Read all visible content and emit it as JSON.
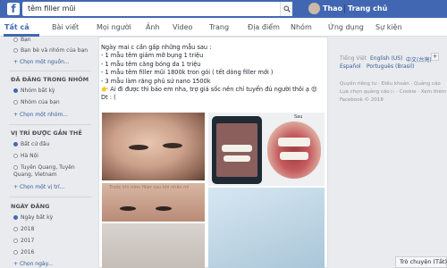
{
  "topbar": {
    "logo": "f",
    "search_value": "têm filler mũi",
    "username": "Thao",
    "home_label": "Trang chủ"
  },
  "tabs": [
    "Tất cả",
    "Bài viết",
    "Mọi người",
    "Ảnh",
    "Video",
    "Trang",
    "Địa điểm",
    "Nhóm",
    "Ứng dụng",
    "Sự kiện"
  ],
  "sidebar": {
    "group1_items": [
      "Bạn",
      "Bạn bè và nhóm của bạn"
    ],
    "group1_link": "Chọn một nguồn...",
    "section2_title": "ĐĂ ĐĂNG TRONG NHÓM",
    "section2_items": [
      "Nhóm bất kỳ",
      "Nhóm của bạn"
    ],
    "section2_link": "Chọn một nhóm...",
    "section3_title": "VỊ TRÍ ĐƯỢC GẮN THẺ",
    "section3_items": [
      "Bất cứ đâu",
      "Hà Nội",
      "Tuyên Quang, Tuyên Quang, Vietnam"
    ],
    "section3_link": "Chọn một vị trí...",
    "section4_title": "NGÀY ĐĂNG",
    "section4_items": [
      "Ngày bất kỳ",
      "2018",
      "2017",
      "2016"
    ],
    "section4_link": "Chọn ngày..."
  },
  "post": {
    "line1": "Ngày mai c cần gấp những mẫu sau :",
    "line2": "- 1 mẫu têm giảm mỡ bụng 1 triệu",
    "line3": "- 1 mẫu têm căng bóng da 1 triệu",
    "line4": "- 1 mẫu têm filler mũi 1800k tron gói ( tết dòng filler mới )",
    "line5": "- 3 mẫu làm răng phủ sứ nano 1500k",
    "line6": "👉 Ai đi được thì báo em nha, trợ giá sốc nên chỉ tuyển đủ người thôi ạ 😍",
    "line7": "Dt : (",
    "caption1": "Trước khi tiêm filler sau khi nhấn mí",
    "caption2": "Sau"
  },
  "right": {
    "lang_current": "Tiếng Việt",
    "lang_en": "English (US)",
    "lang_zh": "中文(台灣)",
    "lang_es": "Español",
    "lang_pt": "Português (Brasil)",
    "lang_plus": "+",
    "footer1": "Quyền riêng tư · Điều khoản · Quảng cáo",
    "footer2": "Lựa chọn quảng cáo ▷ · Cookie · Xem thêm",
    "footer3": "Facebook © 2018"
  },
  "chat_label": "Trò chuyện (Tắt)",
  "colors": {
    "brand": "#4267b2",
    "link": "#365899",
    "background": "#e9ebee"
  }
}
